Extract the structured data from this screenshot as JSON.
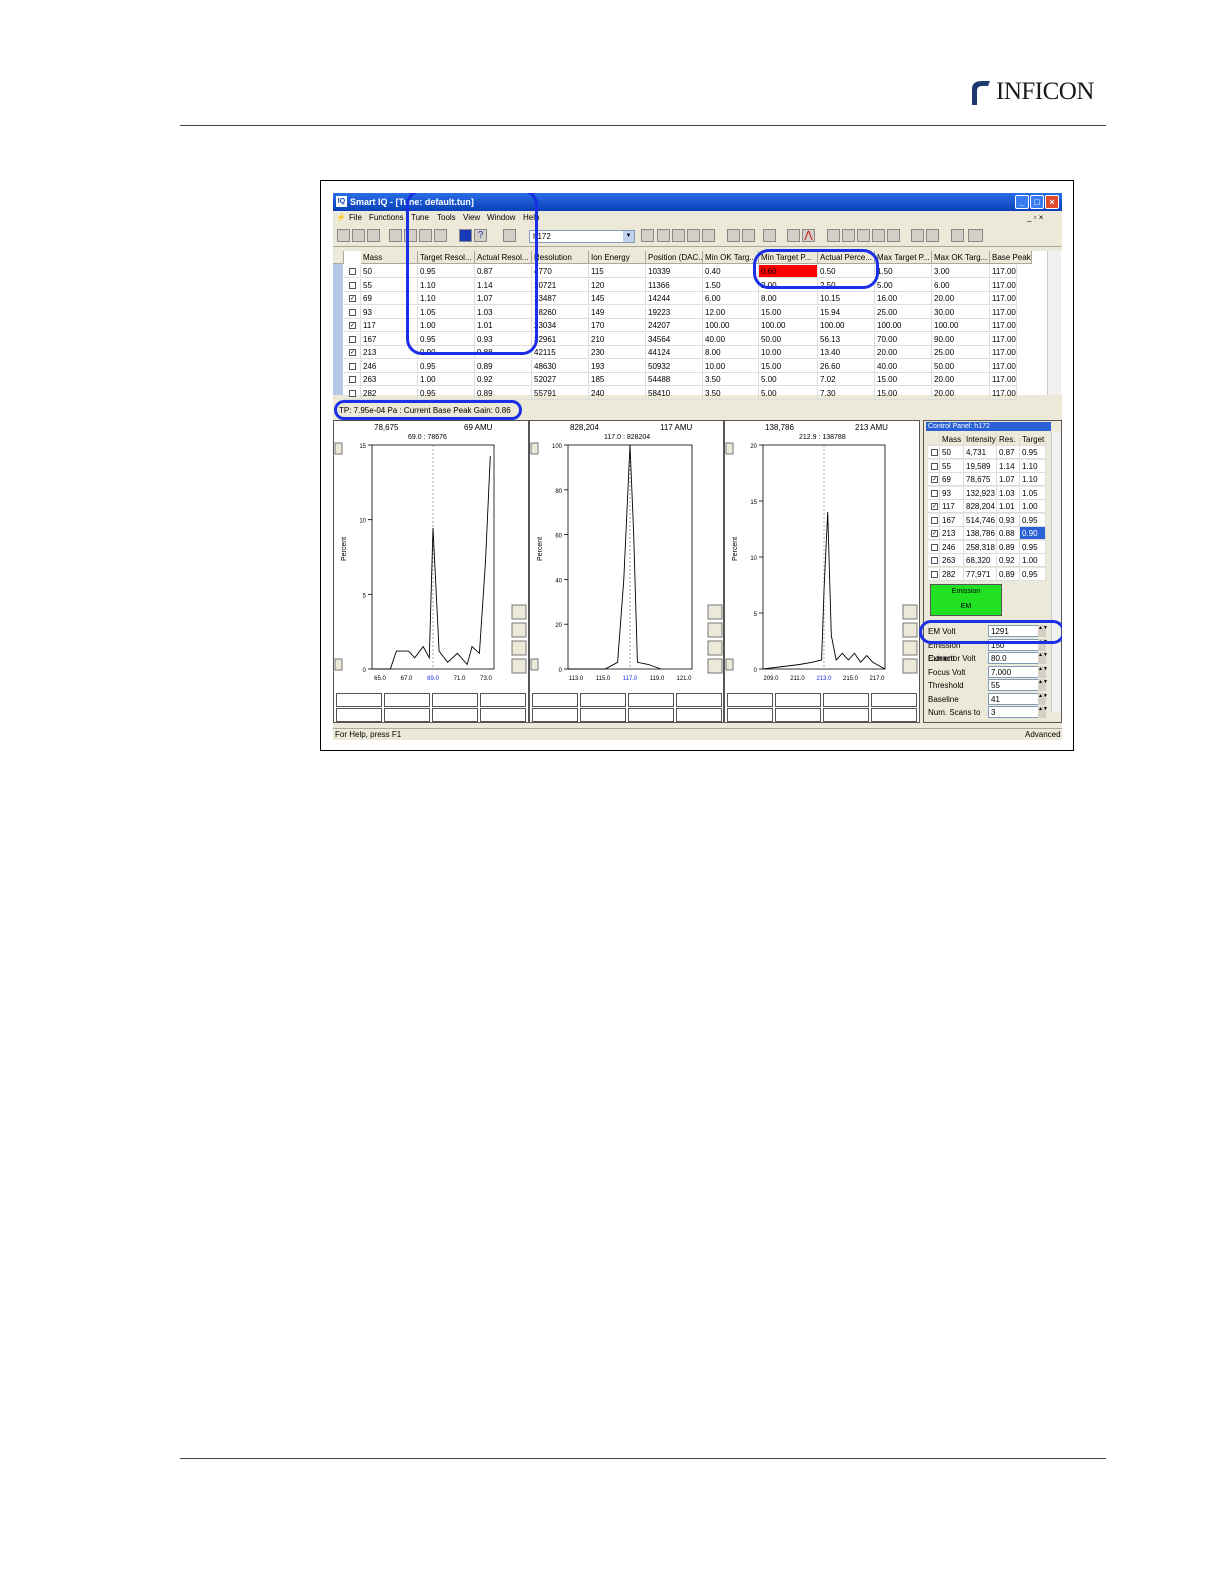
{
  "header": {
    "logo_text": "INFICON"
  },
  "window": {
    "title": "Smart IQ - [Tune: default.tun]",
    "menu": [
      "File",
      "Functions",
      "Tune",
      "Tools",
      "View",
      "Window",
      "Help"
    ],
    "combo_value": "h172"
  },
  "grid": {
    "headers": [
      "Mass",
      "Target Resol...",
      "Actual Resol...",
      "Resolution",
      "Ion Energy",
      "Position (DAC...",
      "Min OK Targ...",
      "Min Target P...",
      "Actual Perce...",
      "Max Target P...",
      "Max OK Targ...",
      "Base Peak"
    ],
    "rows": [
      {
        "checked": false,
        "cells": [
          "50",
          "0.95",
          "0.87",
          "4770",
          "115",
          "10339",
          "0.40",
          "0.60",
          "0.50",
          "1.50",
          "3.00",
          "117.00"
        ]
      },
      {
        "checked": false,
        "cells": [
          "55",
          "1.10",
          "1.14",
          "10721",
          "120",
          "11366",
          "1.50",
          "2.00",
          "2.50",
          "5.00",
          "6.00",
          "117.00"
        ]
      },
      {
        "checked": true,
        "cells": [
          "69",
          "1.10",
          "1.07",
          "13487",
          "145",
          "14244",
          "6.00",
          "8.00",
          "10.15",
          "16.00",
          "20.00",
          "117.00"
        ]
      },
      {
        "checked": false,
        "cells": [
          "93",
          "1.05",
          "1.03",
          "18260",
          "149",
          "19223",
          "12.00",
          "15.00",
          "15.94",
          "25.00",
          "30.00",
          "117.00"
        ]
      },
      {
        "checked": true,
        "cells": [
          "117",
          "1.00",
          "1.01",
          "23034",
          "170",
          "24207",
          "100.00",
          "100.00",
          "100.00",
          "100.00",
          "100.00",
          "117.00"
        ]
      },
      {
        "checked": false,
        "cells": [
          "167",
          "0.95",
          "0.93",
          "32961",
          "210",
          "34564",
          "40.00",
          "50.00",
          "56.13",
          "70.00",
          "90.00",
          "117.00"
        ]
      },
      {
        "checked": true,
        "cells": [
          "213",
          "0.90",
          "0.88",
          "42115",
          "230",
          "44124",
          "8.00",
          "10.00",
          "13.40",
          "20.00",
          "25.00",
          "117.00"
        ]
      },
      {
        "checked": false,
        "cells": [
          "246",
          "0.95",
          "0.89",
          "48630",
          "193",
          "50932",
          "10.00",
          "15.00",
          "26.60",
          "40.00",
          "50.00",
          "117.00"
        ]
      },
      {
        "checked": false,
        "cells": [
          "263",
          "1.00",
          "0.92",
          "52027",
          "185",
          "54488",
          "3.50",
          "5.00",
          "7.02",
          "15.00",
          "20.00",
          "117.00"
        ]
      },
      {
        "checked": false,
        "cells": [
          "282",
          "0.95",
          "0.89",
          "55791",
          "240",
          "58410",
          "3.50",
          "5.00",
          "7.30",
          "15.00",
          "20.00",
          "117.00"
        ]
      }
    ]
  },
  "status_line": "TP: 7.95e-04 Pa : Current Base Peak Gain: 0.86",
  "charts": [
    {
      "top_left": "78,675",
      "top_right": "69 AMU",
      "cursor": "69.0 : 78676",
      "ylabel": "Percent",
      "y_ticks": [
        "15",
        "10",
        "5",
        "0"
      ],
      "x_ticks": [
        "65.0",
        "67.0",
        "69.0",
        "71.0",
        "73.0"
      ]
    },
    {
      "top_left": "828,204",
      "top_right": "117 AMU",
      "cursor": "117.0 : 828204",
      "ylabel": "Percent",
      "y_ticks": [
        "100",
        "80",
        "60",
        "40",
        "20",
        "0"
      ],
      "x_ticks": [
        "113.0",
        "115.0",
        "117.0",
        "119.0",
        "121.0"
      ]
    },
    {
      "top_left": "138,786",
      "top_right": "213 AMU",
      "cursor": "212.9 : 138788",
      "ylabel": "Percent",
      "y_ticks": [
        "20",
        "15",
        "10",
        "5",
        "0"
      ],
      "x_ticks": [
        "209.0",
        "211.0",
        "213.0",
        "215.0",
        "217.0"
      ]
    }
  ],
  "control_panel": {
    "title": "Control Panel: h172",
    "headers": [
      "Mass",
      "Intensity",
      "Res.",
      "Target"
    ],
    "rows": [
      {
        "checked": false,
        "cells": [
          "50",
          "4,731",
          "0.87",
          "0.95"
        ]
      },
      {
        "checked": false,
        "cells": [
          "55",
          "19,589",
          "1.14",
          "1.10"
        ]
      },
      {
        "checked": true,
        "cells": [
          "69",
          "78,675",
          "1.07",
          "1.10"
        ]
      },
      {
        "checked": false,
        "cells": [
          "93",
          "132,923",
          "1.03",
          "1.05"
        ]
      },
      {
        "checked": true,
        "cells": [
          "117",
          "828,204",
          "1.01",
          "1.00"
        ]
      },
      {
        "checked": false,
        "cells": [
          "167",
          "514,746",
          "0.93",
          "0.95"
        ]
      },
      {
        "checked": true,
        "cells": [
          "213",
          "138,786",
          "0.88",
          "0.90"
        ]
      },
      {
        "checked": false,
        "cells": [
          "246",
          "258,318",
          "0.89",
          "0.95"
        ]
      },
      {
        "checked": false,
        "cells": [
          "263",
          "68,320",
          "0.92",
          "1.00"
        ]
      },
      {
        "checked": false,
        "cells": [
          "282",
          "77,971",
          "0.89",
          "0.95"
        ]
      }
    ],
    "emission_label": "Emission",
    "em_label": "EM",
    "params": [
      {
        "label": "EM Volt",
        "value": "1291"
      },
      {
        "label": "Emission Current",
        "value": "150"
      },
      {
        "label": "Extractor Volt",
        "value": "80.0"
      },
      {
        "label": "Focus Volt",
        "value": "7.000"
      },
      {
        "label": "Threshold",
        "value": "55"
      },
      {
        "label": "Baseline",
        "value": "41"
      },
      {
        "label": "Num. Scans to",
        "value": "3"
      }
    ]
  },
  "bottom_status": {
    "help": "For Help, press F1",
    "mode": "Advanced"
  },
  "colors": {
    "highlight": "#1a2fe6",
    "alert": "#ff0000",
    "emission": "#22e022",
    "title_bar": "#0a3fb8"
  }
}
